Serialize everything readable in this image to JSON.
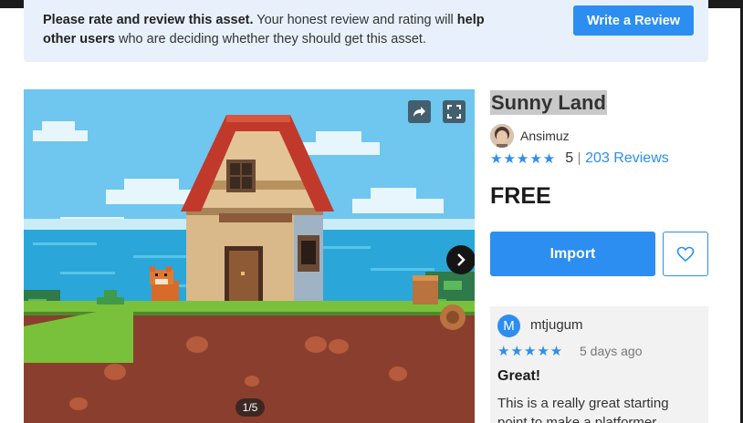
{
  "banner": {
    "bold_1": "Please rate and review this asset.",
    "text_1": " Your honest review and rating will ",
    "bold_2": "help other users",
    "text_2": " who are deciding whether they should get this asset.",
    "button_label": "Write a Review"
  },
  "gallery": {
    "counter": "1/5",
    "icons": [
      "share-icon",
      "fullscreen-icon",
      "chevron-right-icon"
    ]
  },
  "asset": {
    "title": "Sunny Land",
    "publisher": "Ansimuz",
    "stars": "★★★★★",
    "rating": "5",
    "reviews_link": "203 Reviews",
    "price": "FREE",
    "import_label": "Import",
    "favorite_icon": "heart-icon"
  },
  "review": {
    "avatar_letter": "M",
    "user": "mtjugum",
    "stars": "★★★★★",
    "date": "5 days ago",
    "title": "Great!",
    "body": "This is a really great starting point to make a platformer"
  },
  "colors": {
    "accent": "#2b8ef0",
    "banner_bg": "#e8f1fb",
    "card_bg": "#f2f2f2"
  }
}
